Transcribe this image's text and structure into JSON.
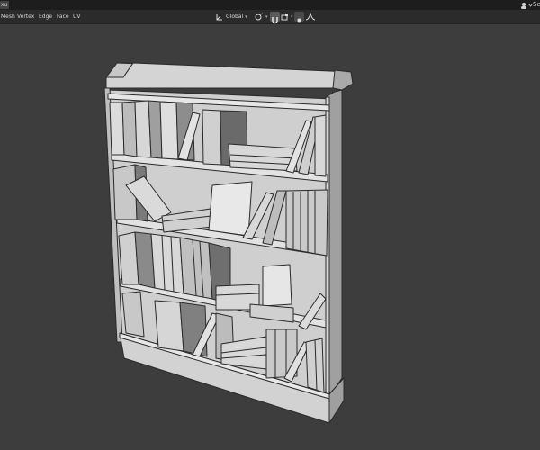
{
  "app": {
    "mode_label": "xu",
    "top_right_label": "Se"
  },
  "menu": {
    "items": [
      "Mesh",
      "Vertex",
      "Edge",
      "Face",
      "UV"
    ]
  },
  "header_tools": {
    "orientation": "Global",
    "orientation_icon": "transform-orientation-icon",
    "pivot_icon": "pivot-icon",
    "snap_icon": "snap-magnet-icon",
    "proportional_icon": "proportional-edit-icon",
    "falloff_icon": "falloff-curve-icon"
  },
  "scene": {
    "object": "bookshelf",
    "colors": {
      "background": "#3d3d3d",
      "frame_light": "#dcdcdc",
      "frame_mid": "#bdbdbd",
      "frame_dark": "#8a8a8a",
      "back_panel": "#cfcfcf",
      "book_light": "#d9d9d9",
      "book_dark": "#555555",
      "edge": "#2a2a2a"
    }
  }
}
